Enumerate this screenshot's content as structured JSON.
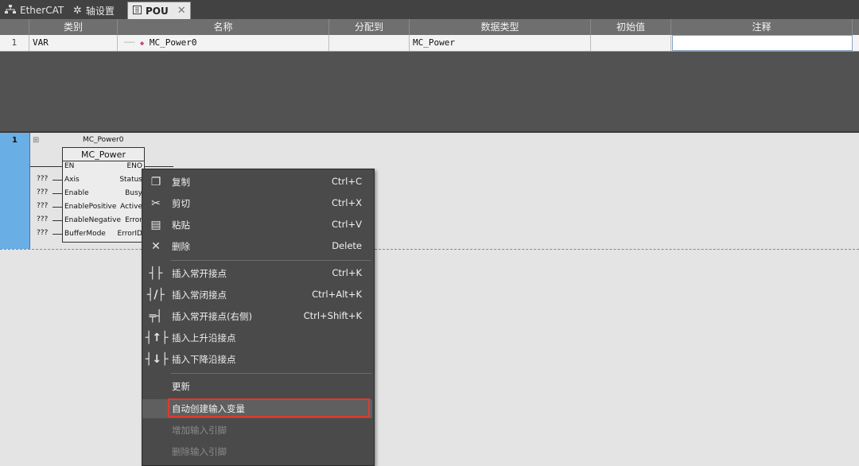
{
  "tabs": [
    {
      "label": "EtherCAT",
      "icon": "network-tree-icon"
    },
    {
      "label": "轴设置",
      "icon": "gear-icon"
    },
    {
      "label": "POU",
      "icon": "pou-icon",
      "active": true
    }
  ],
  "var_table": {
    "headers": [
      "类别",
      "名称",
      "分配到",
      "数据类型",
      "初始值",
      "注释"
    ],
    "rows": [
      {
        "num": "1",
        "category": "VAR",
        "name": "MC_Power0",
        "assign": "",
        "type": "MC_Power",
        "init": "",
        "comment": ""
      }
    ]
  },
  "ladder": {
    "rung_number": "1",
    "expand_symbol": "⊞",
    "fb_instance": "MC_Power0",
    "fb_type": "MC_Power",
    "inputs": [
      "EN",
      "Axis",
      "Enable",
      "EnablePositive",
      "EnableNegative",
      "BufferMode"
    ],
    "outputs": [
      "ENO",
      "Status",
      "Busy",
      "Active",
      "Error",
      "ErrorID"
    ],
    "unassigned": "???"
  },
  "context_menu": {
    "items": [
      {
        "label": "复制",
        "shortcut": "Ctrl+C",
        "icon": "copy-icon"
      },
      {
        "label": "剪切",
        "shortcut": "Ctrl+X",
        "icon": "cut-icon"
      },
      {
        "label": "粘贴",
        "shortcut": "Ctrl+V",
        "icon": "paste-icon"
      },
      {
        "label": "删除",
        "shortcut": "Delete",
        "icon": "delete-icon"
      },
      {
        "label": "插入常开接点",
        "shortcut": "Ctrl+K",
        "icon": "no-contact-icon"
      },
      {
        "label": "插入常闭接点",
        "shortcut": "Ctrl+Alt+K",
        "icon": "nc-contact-icon"
      },
      {
        "label": "插入常开接点(右侧)",
        "shortcut": "Ctrl+Shift+K",
        "icon": "no-contact-right-icon"
      },
      {
        "label": "插入上升沿接点",
        "shortcut": "",
        "icon": "rising-edge-icon"
      },
      {
        "label": "插入下降沿接点",
        "shortcut": "",
        "icon": "falling-edge-icon"
      },
      {
        "label": "更新",
        "shortcut": ""
      },
      {
        "label": "自动创建输入变量",
        "shortcut": ""
      },
      {
        "label": "增加输入引脚",
        "shortcut": "",
        "disabled": true
      },
      {
        "label": "删除输入引脚",
        "shortcut": "",
        "disabled": true
      }
    ]
  },
  "colors": {
    "highlight_border": "#e03a2e",
    "rung_bar": "#6aaee6"
  }
}
